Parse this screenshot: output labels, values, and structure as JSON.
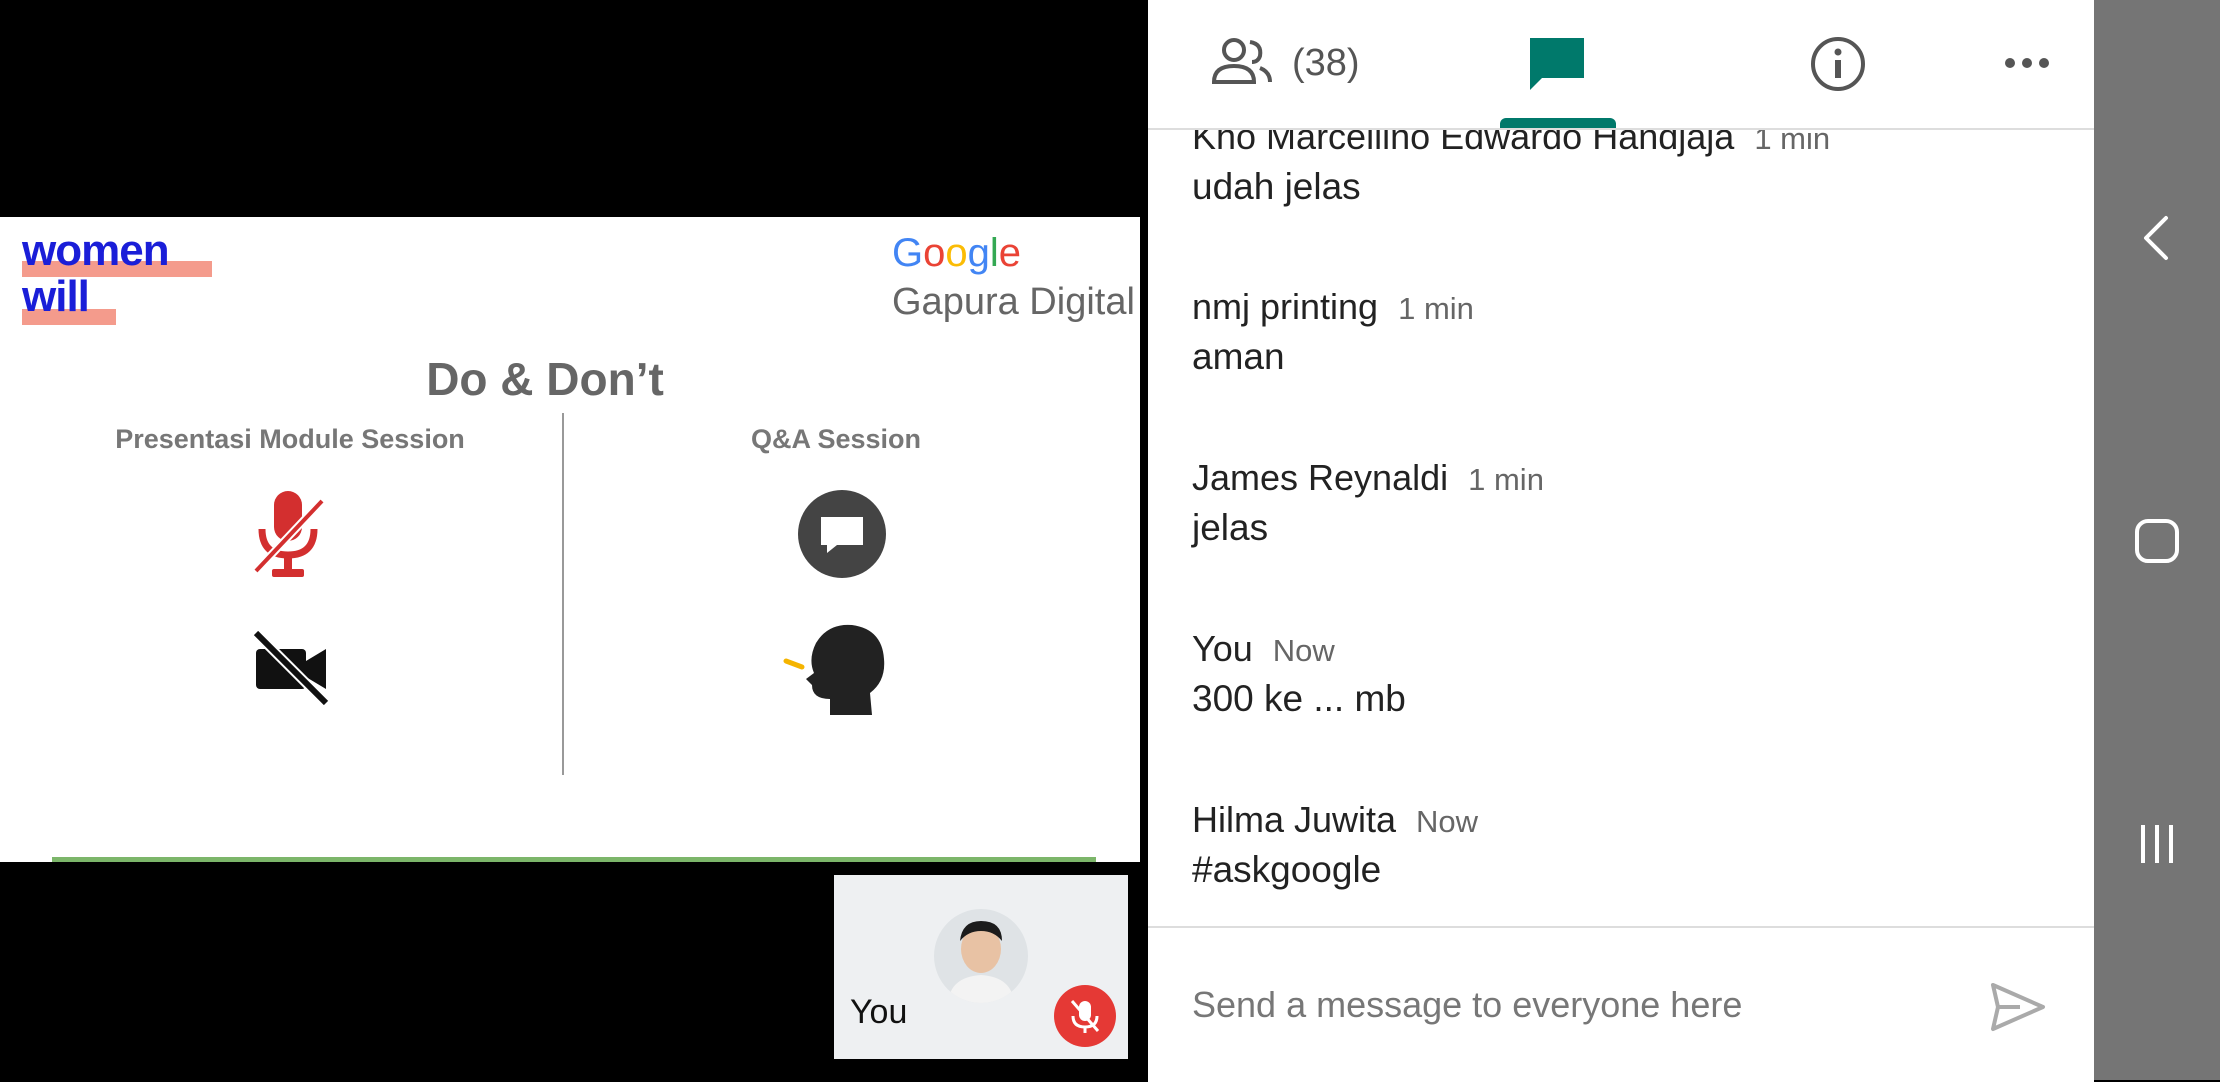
{
  "slide": {
    "brand_line1": "women",
    "brand_line2": "will",
    "google_word": "Google",
    "partner": "Gapura Digital",
    "title": "Do & Don’t",
    "left_heading": "Presentasi Module Session",
    "right_heading": "Q&A Session",
    "icons": [
      "mic-off-icon",
      "videocam-off-icon",
      "chat-bubble-icon",
      "speaking-head-icon"
    ]
  },
  "self_view": {
    "label": "You",
    "icon": "mic-off-icon",
    "accent": "#e53935"
  },
  "tabs": {
    "people_count": "(38)",
    "active_tab": "chat",
    "accent": "#00796b",
    "icons": [
      "people-icon",
      "chat-icon",
      "info-icon",
      "more-icon"
    ]
  },
  "messages": [
    {
      "name": "Kho Marcellino Edwardo Handjaja",
      "time": "1 min",
      "text": "udah jelas"
    },
    {
      "name": "nmj printing",
      "time": "1 min",
      "text": "aman"
    },
    {
      "name": "James Reynaldi",
      "time": "1 min",
      "text": "jelas"
    },
    {
      "name": "You",
      "time": "Now",
      "text": "300 ke ... mb"
    },
    {
      "name": "Hilma Juwita",
      "time": "Now",
      "text": "#askgoogle"
    }
  ],
  "composer": {
    "placeholder": "Send a message to everyone here",
    "icon": "send-icon"
  },
  "navbar": {
    "icons": [
      "back-icon",
      "home-icon",
      "recents-icon"
    ]
  }
}
